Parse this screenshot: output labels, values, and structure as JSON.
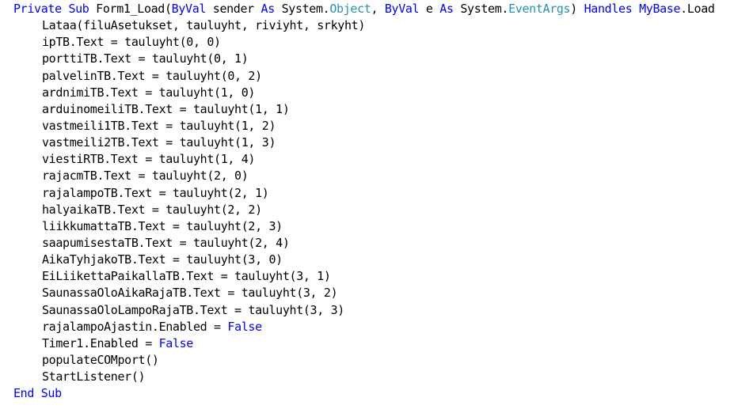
{
  "colors": {
    "keyword": "#0000ff",
    "type": "#2b91af",
    "text": "#000000",
    "background": "#ffffff"
  },
  "code": {
    "lines": [
      {
        "indent": 0,
        "tokens": [
          {
            "t": "kw",
            "v": "Private Sub"
          },
          {
            "t": "plain",
            "v": " Form1_Load("
          },
          {
            "t": "kw",
            "v": "ByVal"
          },
          {
            "t": "plain",
            "v": " sender "
          },
          {
            "t": "kw",
            "v": "As"
          },
          {
            "t": "plain",
            "v": " System."
          },
          {
            "t": "type",
            "v": "Object"
          },
          {
            "t": "plain",
            "v": ", "
          },
          {
            "t": "kw",
            "v": "ByVal"
          },
          {
            "t": "plain",
            "v": " e "
          },
          {
            "t": "kw",
            "v": "As"
          },
          {
            "t": "plain",
            "v": " System."
          },
          {
            "t": "type",
            "v": "EventArgs"
          },
          {
            "t": "plain",
            "v": ") "
          },
          {
            "t": "kw",
            "v": "Handles"
          },
          {
            "t": "plain",
            "v": " "
          },
          {
            "t": "kw",
            "v": "MyBase"
          },
          {
            "t": "plain",
            "v": ".Load"
          }
        ]
      },
      {
        "indent": 1,
        "tokens": [
          {
            "t": "plain",
            "v": "Lataa(filuAsetukset, tauluyht, riviyht, srkyht)"
          }
        ]
      },
      {
        "indent": 1,
        "tokens": [
          {
            "t": "plain",
            "v": "ipTB.Text = tauluyht(0, 0)"
          }
        ]
      },
      {
        "indent": 1,
        "tokens": [
          {
            "t": "plain",
            "v": "porttiTB.Text = tauluyht(0, 1)"
          }
        ]
      },
      {
        "indent": 1,
        "tokens": [
          {
            "t": "plain",
            "v": "palvelinTB.Text = tauluyht(0, 2)"
          }
        ]
      },
      {
        "indent": 1,
        "tokens": [
          {
            "t": "plain",
            "v": "ardnimiTB.Text = tauluyht(1, 0)"
          }
        ]
      },
      {
        "indent": 1,
        "tokens": [
          {
            "t": "plain",
            "v": "arduinomeiliTB.Text = tauluyht(1, 1)"
          }
        ]
      },
      {
        "indent": 1,
        "tokens": [
          {
            "t": "plain",
            "v": "vastmeili1TB.Text = tauluyht(1, 2)"
          }
        ]
      },
      {
        "indent": 1,
        "tokens": [
          {
            "t": "plain",
            "v": "vastmeili2TB.Text = tauluyht(1, 3)"
          }
        ]
      },
      {
        "indent": 1,
        "tokens": [
          {
            "t": "plain",
            "v": "viestiRTB.Text = tauluyht(1, 4)"
          }
        ]
      },
      {
        "indent": 1,
        "tokens": [
          {
            "t": "plain",
            "v": "rajacmTB.Text = tauluyht(2, 0)"
          }
        ]
      },
      {
        "indent": 1,
        "tokens": [
          {
            "t": "plain",
            "v": "rajalampoTB.Text = tauluyht(2, 1)"
          }
        ]
      },
      {
        "indent": 1,
        "tokens": [
          {
            "t": "plain",
            "v": "halyaikaTB.Text = tauluyht(2, 2)"
          }
        ]
      },
      {
        "indent": 1,
        "tokens": [
          {
            "t": "plain",
            "v": "liikkumattaTB.Text = tauluyht(2, 3)"
          }
        ]
      },
      {
        "indent": 1,
        "tokens": [
          {
            "t": "plain",
            "v": "saapumisestaTB.Text = tauluyht(2, 4)"
          }
        ]
      },
      {
        "indent": 1,
        "tokens": [
          {
            "t": "plain",
            "v": "AikaTyhjakoTB.Text = tauluyht(3, 0)"
          }
        ]
      },
      {
        "indent": 1,
        "tokens": [
          {
            "t": "plain",
            "v": "EiLiikettaPaikallaTB.Text = tauluyht(3, 1)"
          }
        ]
      },
      {
        "indent": 1,
        "tokens": [
          {
            "t": "plain",
            "v": "SaunassaOloAikaRajaTB.Text = tauluyht(3, 2)"
          }
        ]
      },
      {
        "indent": 1,
        "tokens": [
          {
            "t": "plain",
            "v": "SaunassaOloLampoRajaTB.Text = tauluyht(3, 3)"
          }
        ]
      },
      {
        "indent": 1,
        "tokens": [
          {
            "t": "plain",
            "v": "rajalampoAjastin.Enabled = "
          },
          {
            "t": "kw",
            "v": "False"
          }
        ]
      },
      {
        "indent": 1,
        "tokens": [
          {
            "t": "plain",
            "v": "Timer1.Enabled = "
          },
          {
            "t": "kw",
            "v": "False"
          }
        ]
      },
      {
        "indent": 1,
        "tokens": [
          {
            "t": "plain",
            "v": "populateCOMport()"
          }
        ]
      },
      {
        "indent": 1,
        "tokens": [
          {
            "t": "plain",
            "v": "StartListener()"
          }
        ]
      },
      {
        "indent": 0,
        "tokens": [
          {
            "t": "kw",
            "v": "End Sub"
          }
        ]
      }
    ]
  }
}
